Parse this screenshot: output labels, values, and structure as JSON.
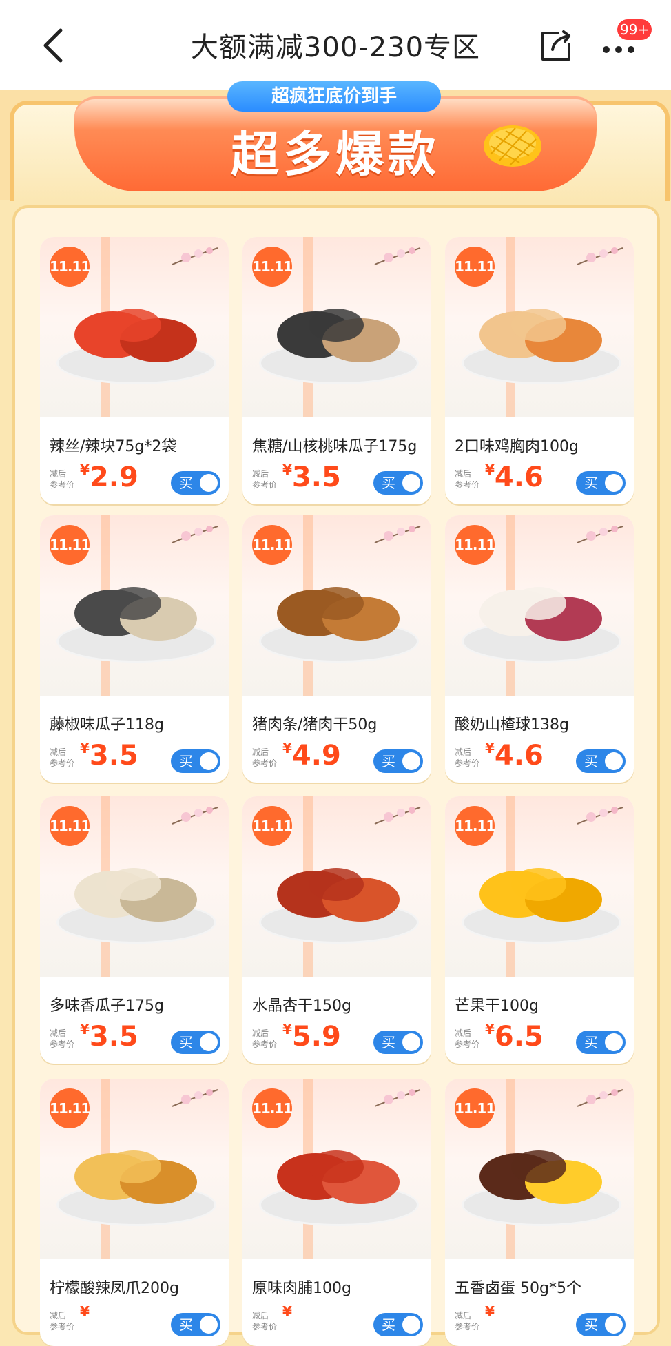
{
  "header": {
    "title": "大额满减300-230专区",
    "badge": "99+"
  },
  "banner": {
    "subtitle": "超疯狂底价到手",
    "title": "超多爆款"
  },
  "labels": {
    "ref_price": "减后\n参考价",
    "currency": "¥",
    "buy": "买",
    "tag": "11.11"
  },
  "products": [
    {
      "name": "辣丝/辣块75g*2袋",
      "price": "2.9"
    },
    {
      "name": "焦糖/山核桃味瓜子175g",
      "price": "3.5"
    },
    {
      "name": "2口味鸡胸肉100g",
      "price": "4.6"
    },
    {
      "name": "藤椒味瓜子118g",
      "price": "3.5"
    },
    {
      "name": "猪肉条/猪肉干50g",
      "price": "4.9"
    },
    {
      "name": "酸奶山楂球138g",
      "price": "4.6"
    },
    {
      "name": "多味香瓜子175g",
      "price": "3.5"
    },
    {
      "name": "水晶杏干150g",
      "price": "5.9"
    },
    {
      "name": "芒果干100g",
      "price": "6.5"
    },
    {
      "name": "柠檬酸辣凤爪200g",
      "price": ""
    },
    {
      "name": "原味肉脯100g",
      "price": ""
    },
    {
      "name": "五香卤蛋 50g*5个",
      "price": ""
    }
  ],
  "colors": {
    "accent": "#ff4a1a",
    "buy_button": "#2d86e8",
    "banner": "#ff6a35"
  }
}
